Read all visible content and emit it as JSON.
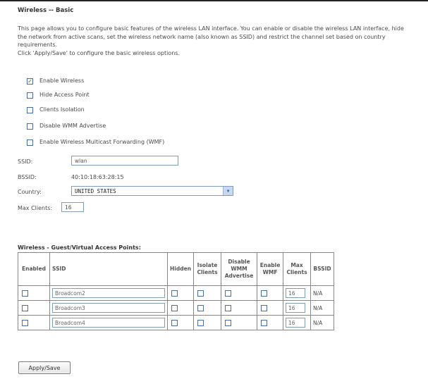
{
  "page": {
    "title": "Wireless -- Basic",
    "description": [
      "This page allows you to configure basic features of the wireless LAN interface. You can enable or disable the wireless LAN interface, hide the network from active scans, set the wireless network name (also known as SSID) and restrict the channel set based on country requirements.",
      "Click 'Apply/Save' to configure the basic wireless options."
    ]
  },
  "options": [
    {
      "label": "Enable Wireless",
      "checked": true
    },
    {
      "label": "Hide Access Point",
      "checked": false
    },
    {
      "label": "Clients Isolation",
      "checked": false
    },
    {
      "label": "Disable WMM Advertise",
      "checked": false
    },
    {
      "label": "Enable Wireless Multicast Forwarding (WMF)",
      "checked": false
    }
  ],
  "fields": {
    "ssid_label": "SSID:",
    "ssid_value": "wlan",
    "bssid_label": "BSSID:",
    "bssid_value": "40:10:18:63:28:15",
    "country_label": "Country:",
    "country_value": "UNITED STATES",
    "max_clients_label": "Max Clients:",
    "max_clients_value": "16"
  },
  "guest": {
    "title": "Wireless - Guest/Virtual Access Points:",
    "headers": [
      "Enabled",
      "SSID",
      "Hidden",
      "Isolate Clients",
      "Disable WMM Advertise",
      "Enable WMF",
      "Max Clients",
      "BSSID"
    ],
    "rows": [
      {
        "ssid": "Broadcom2",
        "max_clients": "16",
        "bssid": "N/A"
      },
      {
        "ssid": "Broadcom3",
        "max_clients": "16",
        "bssid": "N/A"
      },
      {
        "ssid": "Broadcom4",
        "max_clients": "16",
        "bssid": "N/A"
      }
    ]
  },
  "apply_button": "Apply/Save",
  "colors": {
    "check": "#2e7d32",
    "input_border": "#7f9db9"
  }
}
